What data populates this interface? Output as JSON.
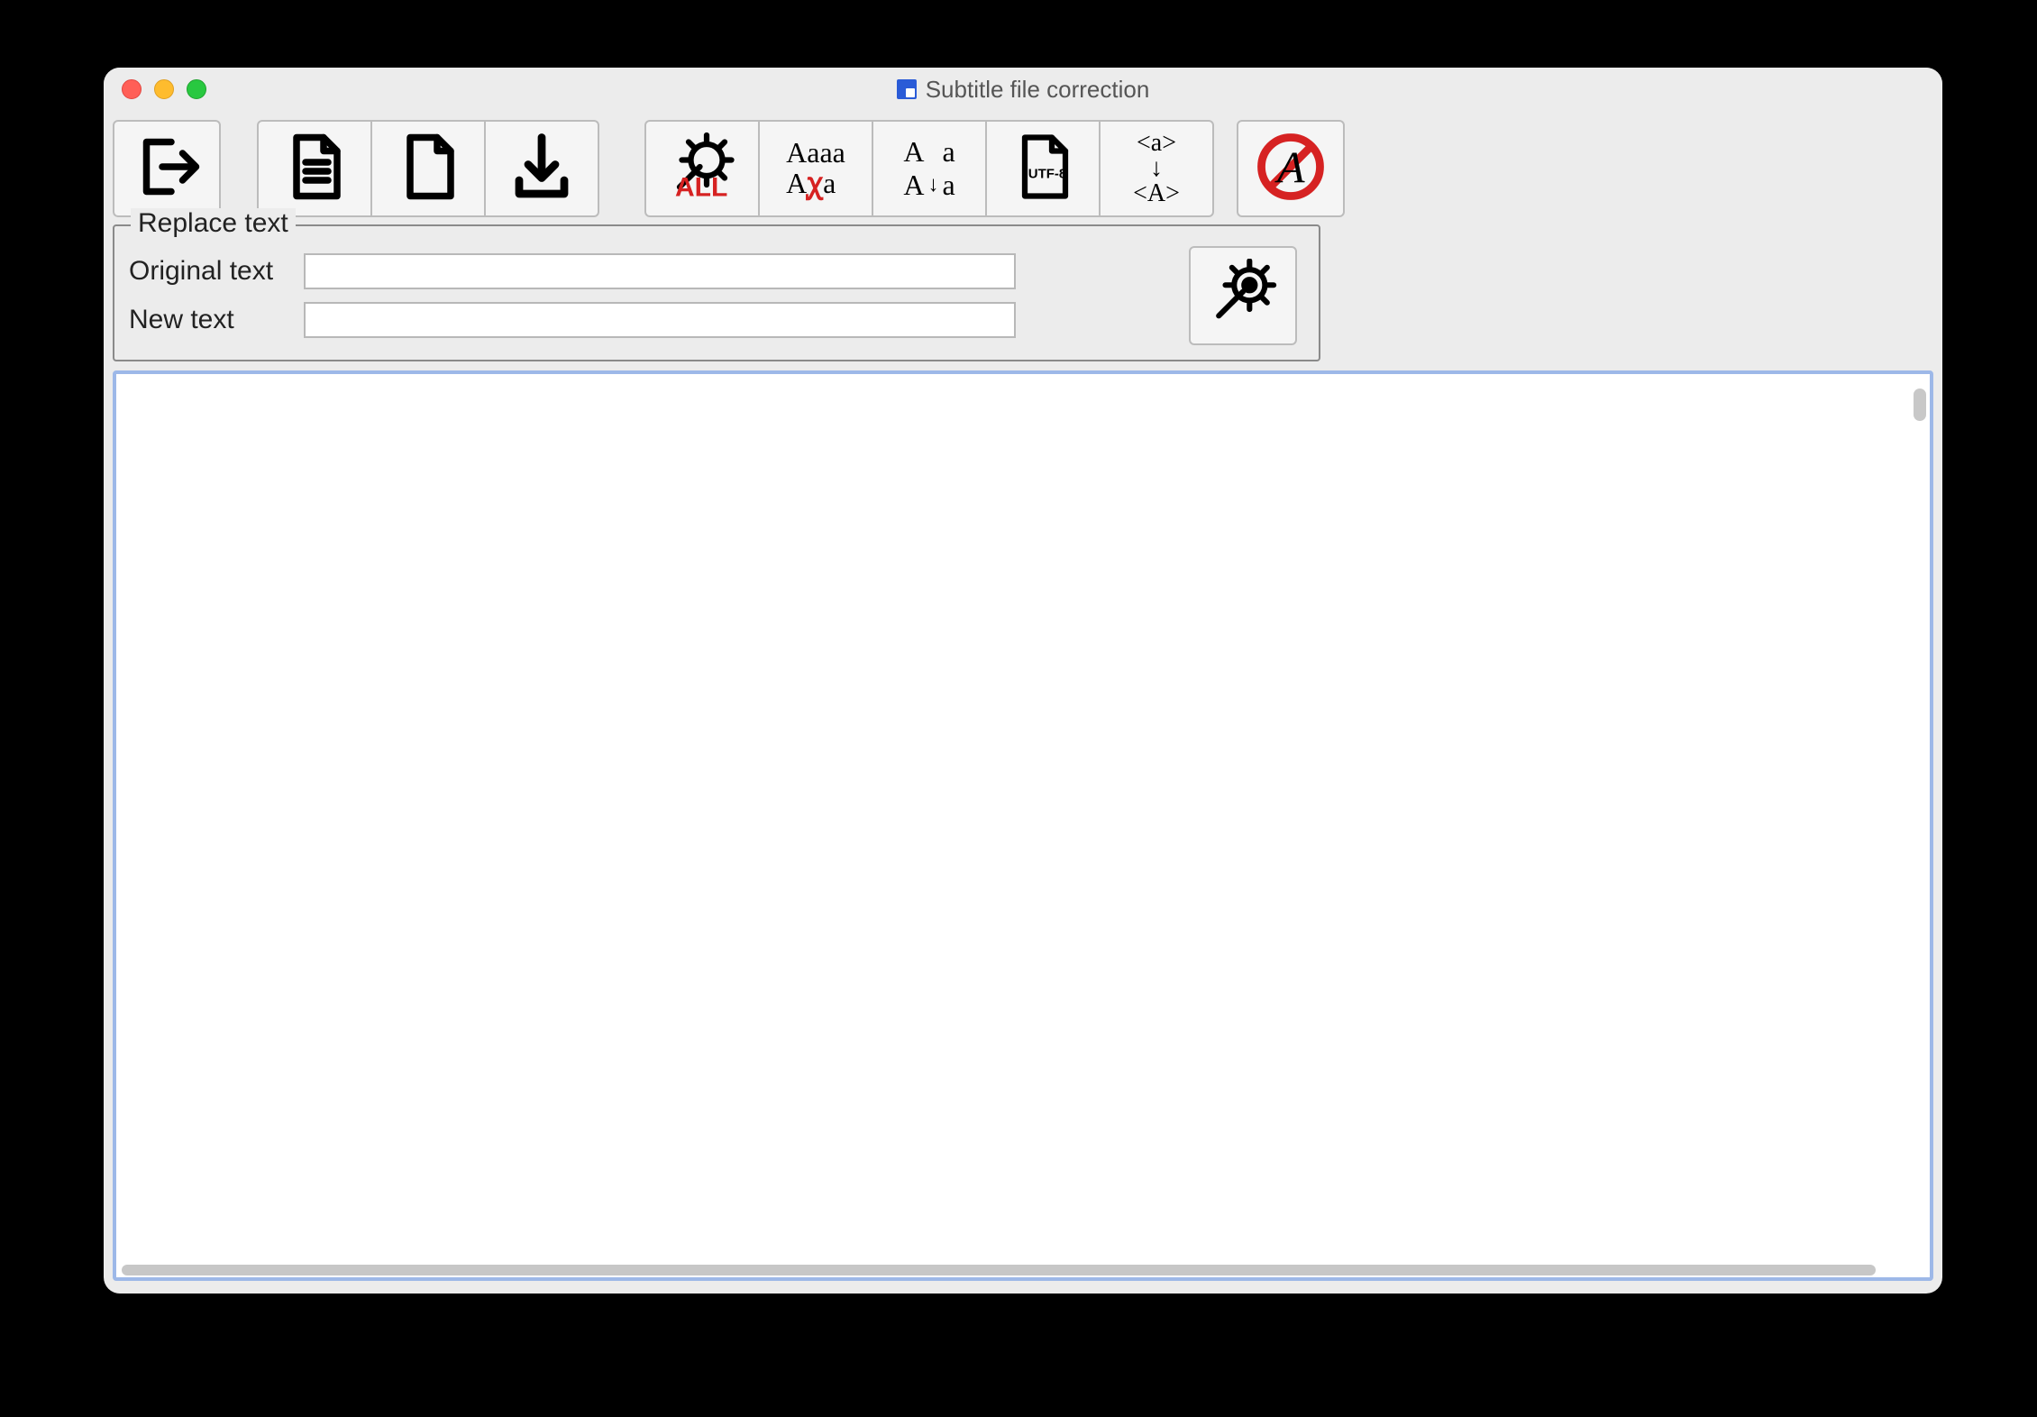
{
  "window": {
    "title": "Subtitle file correction"
  },
  "toolbar": {
    "exit_name": "exit",
    "open_name": "open-file",
    "new_name": "new-file",
    "save_name": "save",
    "fix_all_name": "fix-all",
    "remove_dup_name": "remove-duplicate-lines",
    "case_name": "change-case",
    "utf8_name": "convert-utf8",
    "tag_name": "convert-tag-case",
    "disable_name": "remove-formatting"
  },
  "replace": {
    "legend": "Replace text",
    "original_label": "Original text",
    "original_value": "",
    "new_label": "New text",
    "new_value": "",
    "action_name": "run-replace"
  },
  "editor": {
    "value": ""
  }
}
